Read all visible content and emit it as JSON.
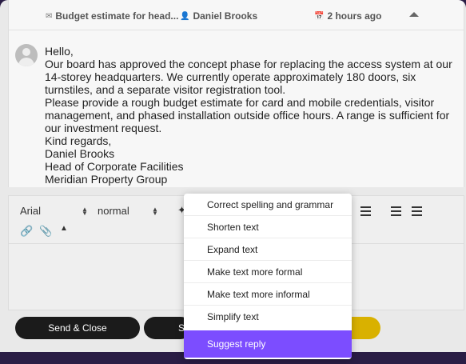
{
  "message": {
    "subject": "Budget estimate for head...",
    "sender": "Daniel Brooks",
    "time": "2 hours ago",
    "body_lines": [
      "Hello,",
      "Our board has approved the concept phase for replacing the access system at our",
      "14-storey headquarters. We currently operate approximately 180 doors, six",
      "turnstiles, and a separate visitor registration tool.",
      "Please provide a rough budget estimate for card and mobile credentials, visitor",
      "management, and phased installation outside office hours. A range is sufficient for",
      "our investment request.",
      "Kind regards,",
      "Daniel Brooks",
      "Head of Corporate Facilities",
      "Meridian Property Group"
    ]
  },
  "editor": {
    "font_value": "Arial",
    "size_value": "normal"
  },
  "buttons": {
    "send_close": "Send & Close",
    "second_partial": "S"
  },
  "ai_menu": {
    "items": [
      "Correct spelling and grammar",
      "Shorten text",
      "Expand text",
      "Make text more formal",
      "Make text more informal",
      "Simplify text"
    ],
    "primary": "Suggest reply"
  },
  "colors": {
    "accent": "#7c4dff",
    "dark_button": "#1b1b1b",
    "yellow_button": "#d9b100",
    "page_background": "#2a1d45"
  }
}
